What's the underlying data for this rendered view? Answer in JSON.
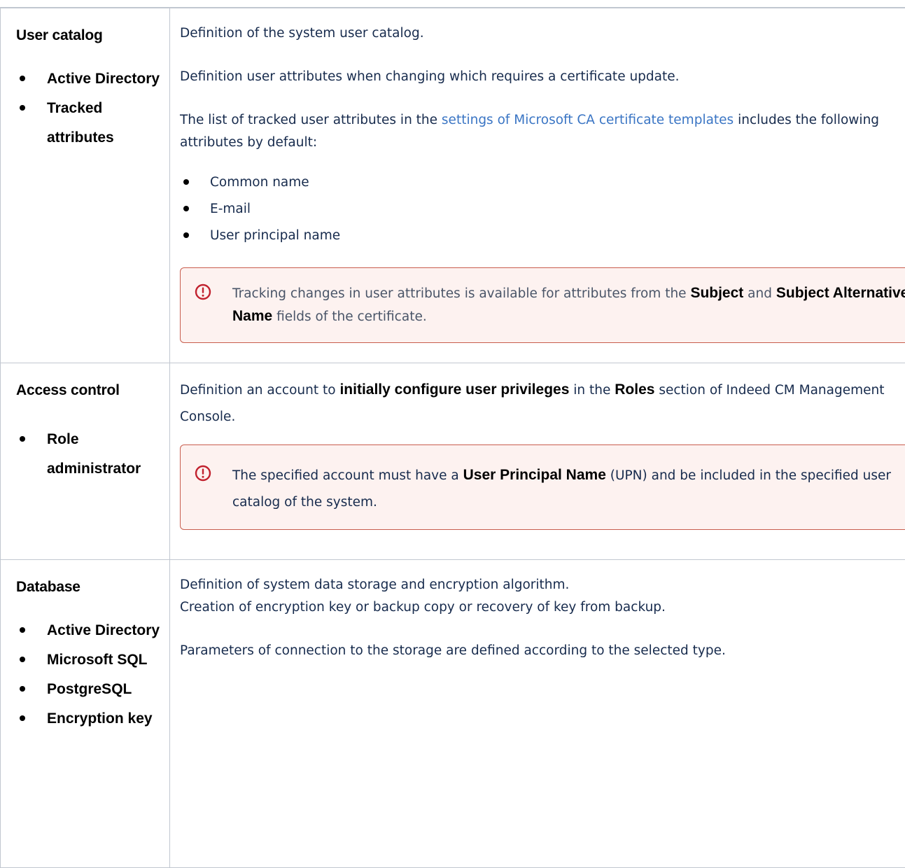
{
  "rows": [
    {
      "heading": "User catalog",
      "items": [
        "Active Directory",
        "Tracked attributes"
      ],
      "p1": "Definition of the system user catalog.",
      "p2": "Definition user attributes when changing which requires a certificate update.",
      "p3_before": "The list of tracked user attributes in the ",
      "p3_link": "settings of Microsoft CA certificate templates",
      "p3_after": " includes the following attributes by default:",
      "list": [
        "Common name",
        "E-mail",
        "User principal name"
      ],
      "warn_before": "Tracking changes in user attributes is available for attributes from the ",
      "warn_b1": "Subject",
      "warn_mid": " and ",
      "warn_b2": "Subject Alternative Name",
      "warn_after": " fields of the certificate.",
      "warn_icon": "exclamation-circle-icon"
    },
    {
      "heading": "Access control",
      "items": [
        "Role administrator"
      ],
      "p_before": "Definition an account to ",
      "p_b1": "initially configure user privileges",
      "p_mid": " in the ",
      "p_b2": "Roles",
      "p_after": " section of Indeed CM Management Console.",
      "warn_before": "The specified account must have a ",
      "warn_b1": "User Principal Name",
      "warn_after": " (UPN) and be included in the specified user catalog of the system.",
      "warn_icon": "exclamation-circle-icon"
    },
    {
      "heading": "Database",
      "items": [
        "Active Directory",
        "Microsoft SQL",
        "PostgreSQL",
        "Encryption key"
      ],
      "p1": "Definition of system data storage and encryption algorithm.",
      "p2": "Creation of encryption key or backup copy or recovery of key from backup.",
      "p3": "Parameters of connection to the storage are defined according to the selected type."
    }
  ],
  "colors": {
    "link": "#3a75c4",
    "warn_border": "#c85d4d",
    "warn_bg": "#fdf2f0",
    "grid": "#c1c7d0"
  }
}
